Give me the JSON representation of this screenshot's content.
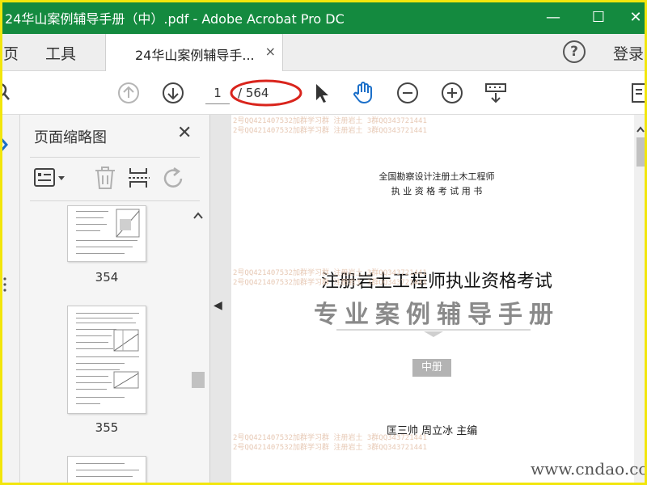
{
  "window": {
    "title": "24华山案例辅导手册（中）.pdf - Adobe Acrobat Pro DC",
    "minimize": "—",
    "maximize": "☐",
    "close": "✕"
  },
  "menubar": {
    "home_label": "页",
    "tools_label": "工具",
    "doc_tab_label": "24华山案例辅导手...",
    "doc_tab_close": "×",
    "help": "?",
    "login_label": "登录"
  },
  "toolbar": {
    "current_page": "1",
    "total_pages": "/ 564",
    "icons": [
      "search-icon",
      "prev-page-icon",
      "next-page-icon",
      "select-cursor-icon",
      "hand-tool-icon",
      "zoom-out-icon",
      "zoom-in-icon",
      "page-display-icon"
    ],
    "accent_color": "#1b6fc9",
    "annotation_color": "#d9241c"
  },
  "thumbnail_panel": {
    "title": "页面缩略图",
    "close": "✕",
    "tools": [
      "options-menu-icon",
      "delete-icon",
      "extract-icon",
      "rotate-icon"
    ],
    "thumbnails": [
      {
        "page": "354"
      },
      {
        "page": "355"
      }
    ]
  },
  "document": {
    "publisher_line1": "全国勘察设计注册土木工程师",
    "publisher_line2": "执 业 资 格 考 试 用 书",
    "main_title": "注册岩土工程师执业资格考试",
    "sub_title": "专业案例辅导手册",
    "volume": "中册",
    "authors": "匡三帅    周立冰    主编",
    "watermark_lines": [
      "2号QQ421407532加群学习群 注册岩土 3群QQ343721441",
      "2号QQ421407532加群学习群 注册岩土 3群QQ343721441"
    ],
    "site_watermark": "www.cndao.com"
  },
  "colors": {
    "titlebar": "#148a3f",
    "frame": "#f2e60c"
  }
}
